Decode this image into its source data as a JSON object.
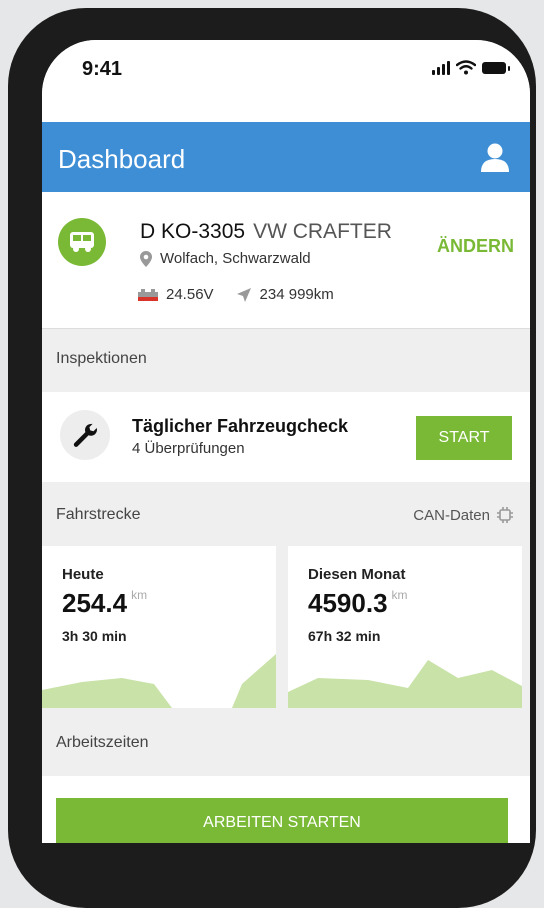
{
  "status_bar": {
    "time": "9:41"
  },
  "header": {
    "title": "Dashboard"
  },
  "vehicle": {
    "plate": "D KO-3305",
    "model": "VW CRAFTER",
    "location": "Wolfach, Schwarzwald",
    "voltage": "24.56V",
    "mileage": "234 999km",
    "change_label": "ÄNDERN"
  },
  "inspections": {
    "section_label": "Inspektionen",
    "title": "Täglicher Fahrzeugcheck",
    "subtitle": "4 Überprüfungen",
    "start_label": "START"
  },
  "distance": {
    "section_label": "Fahrstrecke",
    "can_label": "CAN-Daten",
    "cards": [
      {
        "title": "Heute",
        "value": "254.4",
        "unit": "km",
        "time": "3h 30 min"
      },
      {
        "title": "Diesen Monat",
        "value": "4590.3",
        "unit": "km",
        "time": "67h 32 min"
      }
    ]
  },
  "work": {
    "section_label": "Arbeitszeiten",
    "button_label": "ARBEITEN STARTEN"
  },
  "colors": {
    "header_blue": "#3e8ed6",
    "accent_green": "#7ab936",
    "chart_green": "#c9e2a8"
  },
  "icons": [
    "signal-icon",
    "wifi-icon",
    "battery-icon",
    "user-icon",
    "bus-icon",
    "location-pin-icon",
    "car-battery-icon",
    "navigation-arrow-icon",
    "wrench-icon",
    "chip-icon"
  ]
}
